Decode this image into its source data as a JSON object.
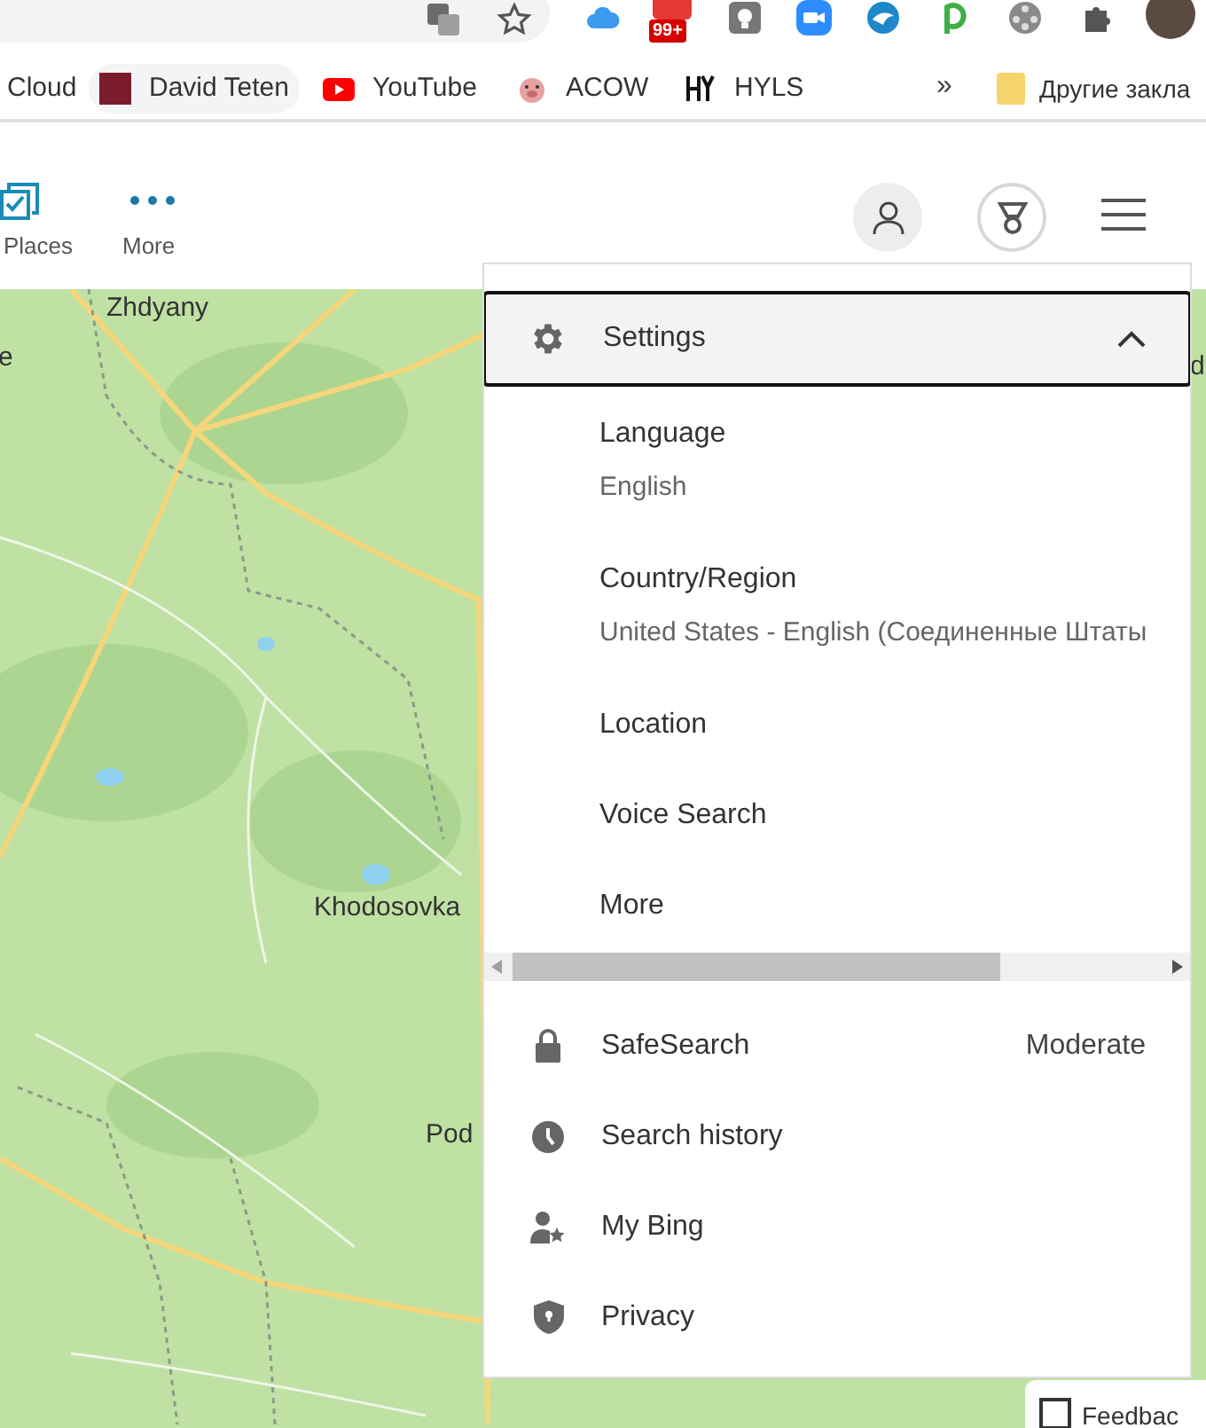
{
  "browser": {
    "badge": "99+",
    "bookmarks": [
      {
        "label": "Cloud"
      },
      {
        "label": "David Teten",
        "hovered": true
      },
      {
        "label": "YouTube",
        "hovered": false
      },
      {
        "label": "ACOW",
        "hovered": false
      },
      {
        "label": "HYLS",
        "hovered": false
      }
    ],
    "more_bookmarks": "»",
    "other_bookmarks": "Другие закла"
  },
  "header": {
    "nav": [
      {
        "label": "Places"
      },
      {
        "label": "More"
      }
    ]
  },
  "map": {
    "labels": [
      {
        "text": "Zhdyany"
      },
      {
        "text": "e"
      },
      {
        "text": "Khodosovka"
      },
      {
        "text": "Pod"
      },
      {
        "text": "d"
      }
    ]
  },
  "settings_menu": {
    "header": {
      "label": "Settings",
      "expanded": true
    },
    "settings": [
      {
        "label": "Language",
        "value": "English"
      },
      {
        "label": "Country/Region",
        "value": "United States - English (Соединенные Штаты"
      },
      {
        "label": "Location"
      },
      {
        "label": "Voice Search"
      },
      {
        "label": "More"
      }
    ],
    "items": [
      {
        "label": "SafeSearch",
        "value": "Moderate"
      },
      {
        "label": "Search history"
      },
      {
        "label": "My Bing"
      },
      {
        "label": "Privacy"
      }
    ]
  },
  "feedback": {
    "label": "Feedbac",
    "checked": false
  }
}
